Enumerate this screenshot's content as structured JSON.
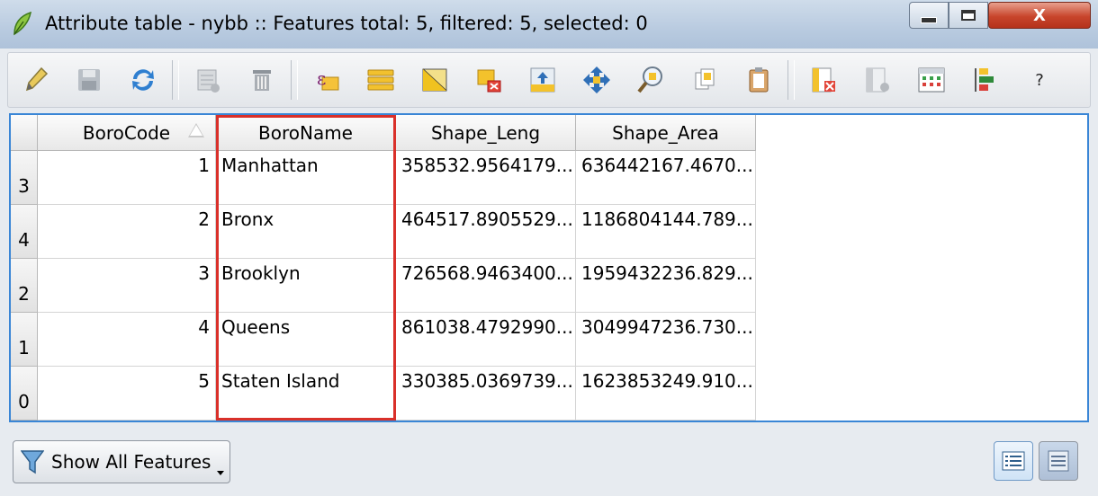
{
  "window": {
    "title": "Attribute table - nybb :: Features total: 5, filtered: 5, selected: 0",
    "controls": {
      "minimize": "minimize-icon",
      "maximize": "maximize-icon",
      "close": "X"
    }
  },
  "toolbar": {
    "icons": [
      "pencil-edit-icon",
      "save-edits-icon",
      "reload-icon",
      "delete-selected-icon",
      "delete-icon",
      "expression-select-icon",
      "select-all-icon",
      "invert-selection-icon",
      "deselect-all-icon",
      "move-selection-to-top-icon",
      "pan-to-selection-icon",
      "zoom-to-selection-icon",
      "copy-rows-icon",
      "paste-features-icon",
      "delete-column-icon",
      "add-column-icon",
      "field-calculator-icon",
      "conditional-formatting-icon"
    ],
    "help_label": "?"
  },
  "table": {
    "columns": [
      "BoroCode",
      "BoroName",
      "Shape_Leng",
      "Shape_Area"
    ],
    "sort_column": "BoroCode",
    "rows": [
      {
        "id": "3",
        "BoroCode": "1",
        "BoroName": "Manhattan",
        "Shape_Leng": "358532.9564179...",
        "Shape_Area": "636442167.4670..."
      },
      {
        "id": "4",
        "BoroCode": "2",
        "BoroName": "Bronx",
        "Shape_Leng": "464517.8905529...",
        "Shape_Area": "1186804144.789..."
      },
      {
        "id": "2",
        "BoroCode": "3",
        "BoroName": "Brooklyn",
        "Shape_Leng": "726568.9463400...",
        "Shape_Area": "1959432236.829..."
      },
      {
        "id": "1",
        "BoroCode": "4",
        "BoroName": "Queens",
        "Shape_Leng": "861038.4792990...",
        "Shape_Area": "3049947236.730..."
      },
      {
        "id": "0",
        "BoroCode": "5",
        "BoroName": "Staten Island",
        "Shape_Leng": "330385.0369739...",
        "Shape_Area": "1623853249.910..."
      }
    ],
    "highlight_color": "#d9302a",
    "frame_color": "#3a86d6"
  },
  "footer": {
    "filter_button_label": "Show All Features",
    "filter_icon": "funnel-icon",
    "table_view_icon": "table-view-icon",
    "form_view_icon": "form-view-icon"
  }
}
